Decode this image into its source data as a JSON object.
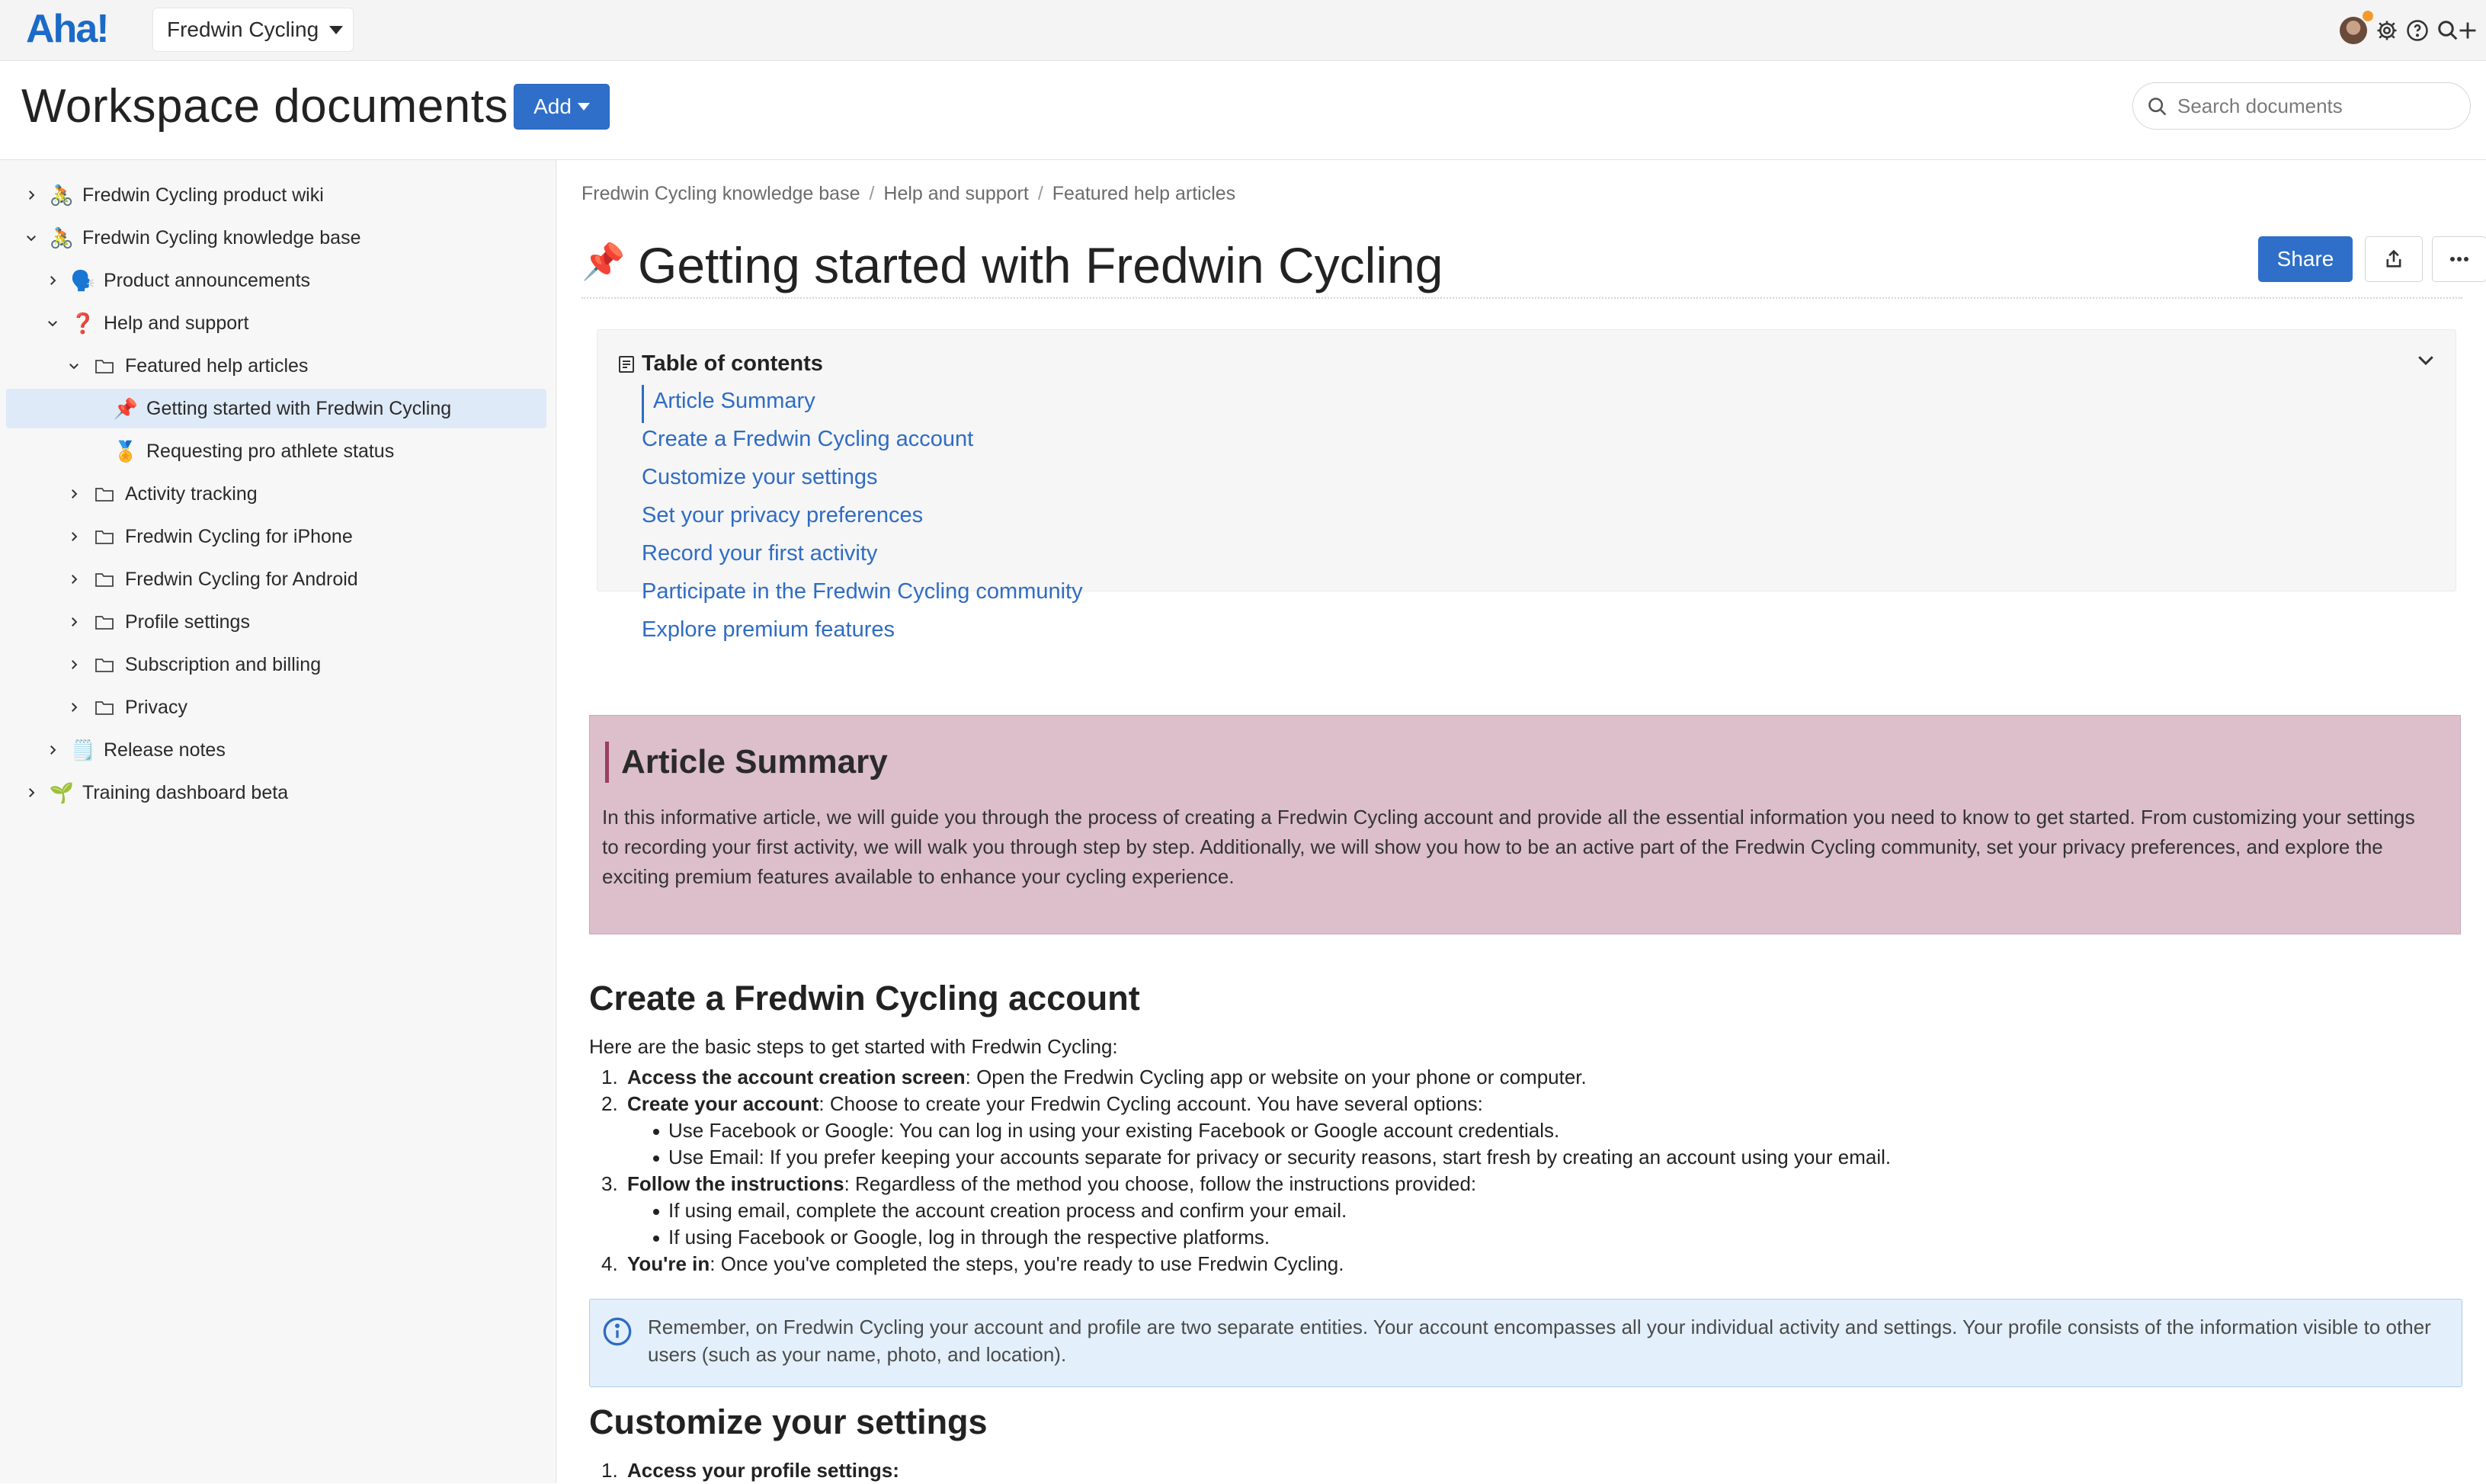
{
  "topbar": {
    "logo": "Aha!",
    "workspace": "Fredwin Cycling"
  },
  "header": {
    "title": "Workspace documents",
    "add_label": "Add",
    "search_placeholder": "Search documents"
  },
  "sidebar": {
    "items": [
      {
        "label": "Fredwin Cycling product wiki",
        "icon": "🚴",
        "level": 0,
        "expanded": false,
        "kind": "emoji"
      },
      {
        "label": "Fredwin Cycling knowledge base",
        "icon": "🚴",
        "level": 0,
        "expanded": true,
        "kind": "emoji"
      },
      {
        "label": "Product announcements",
        "icon": "🗣️",
        "level": 1,
        "expanded": false,
        "kind": "emoji"
      },
      {
        "label": "Help and support",
        "icon": "❓",
        "level": 1,
        "expanded": true,
        "kind": "emoji"
      },
      {
        "label": "Featured help articles",
        "icon": "folder",
        "level": 2,
        "expanded": true,
        "kind": "folder"
      },
      {
        "label": "Getting started with Fredwin Cycling",
        "icon": "📌",
        "level": 3,
        "expanded": null,
        "kind": "emoji",
        "selected": true
      },
      {
        "label": "Requesting pro athlete status",
        "icon": "🏅",
        "level": 3,
        "expanded": null,
        "kind": "emoji"
      },
      {
        "label": "Activity tracking",
        "icon": "folder",
        "level": 2,
        "expanded": false,
        "kind": "folder"
      },
      {
        "label": "Fredwin Cycling for iPhone",
        "icon": "folder",
        "level": 2,
        "expanded": false,
        "kind": "folder"
      },
      {
        "label": "Fredwin Cycling for Android",
        "icon": "folder",
        "level": 2,
        "expanded": false,
        "kind": "folder"
      },
      {
        "label": "Profile settings",
        "icon": "folder",
        "level": 2,
        "expanded": false,
        "kind": "folder"
      },
      {
        "label": "Subscription and billing",
        "icon": "folder",
        "level": 2,
        "expanded": false,
        "kind": "folder"
      },
      {
        "label": "Privacy",
        "icon": "folder",
        "level": 2,
        "expanded": false,
        "kind": "folder"
      },
      {
        "label": "Release notes",
        "icon": "🗒️",
        "level": 1,
        "expanded": false,
        "kind": "emoji"
      },
      {
        "label": "Training dashboard beta",
        "icon": "🌱",
        "level": 0,
        "expanded": false,
        "kind": "emoji"
      }
    ]
  },
  "main": {
    "breadcrumb": [
      "Fredwin Cycling knowledge base",
      "Help and support",
      "Featured help articles"
    ],
    "doc_icon": "📌",
    "doc_title": "Getting started with Fredwin Cycling",
    "share_label": "Share",
    "toc": {
      "title": "Table of contents",
      "items": [
        "Article Summary",
        "Create a Fredwin Cycling account",
        "Customize your settings",
        "Set your privacy preferences",
        "Record your first activity",
        "Participate in the Fredwin Cycling community",
        "Explore premium features"
      ]
    },
    "summary": {
      "title": "Article Summary",
      "body": "In this informative article, we will guide you through the process of creating a Fredwin Cycling account and provide all the essential information you need to know to get started. From customizing your settings to recording your first activity, we will walk you through step by step. Additionally, we will show you how to be an active part of the Fredwin Cycling community, set your privacy preferences, and explore the exciting premium features available to enhance your cycling experience."
    },
    "section1": {
      "title": "Create a Fredwin Cycling account",
      "intro": "Here are the basic steps to get started with Fredwin Cycling:",
      "steps": [
        {
          "num": "1.",
          "bold": "Access the account creation screen",
          "text": ": Open the Fredwin Cycling app or website on your phone or computer.",
          "subs": []
        },
        {
          "num": "2.",
          "bold": "Create your account",
          "text": ": Choose to create your Fredwin Cycling account. You have several options:",
          "subs": [
            "Use Facebook or Google: You can log in using your existing Facebook or Google account credentials.",
            "Use Email: If you prefer keeping your accounts separate for privacy or security reasons, start fresh by creating an account using your email."
          ]
        },
        {
          "num": "3.",
          "bold": "Follow the instructions",
          "text": ": Regardless of the method you choose, follow the instructions provided:",
          "subs": [
            "If using email, complete the account creation process and confirm your email.",
            "If using Facebook or Google, log in through the respective platforms."
          ]
        },
        {
          "num": "4.",
          "bold": "You're in",
          "text": ": Once you've completed the steps, you're ready to use Fredwin Cycling.",
          "subs": []
        }
      ],
      "note": "Remember, on Fredwin Cycling your account and profile are two separate entities. Your account encompasses all your individual activity and settings. Your profile consists of the information visible to other users (such as your name, photo, and location)."
    },
    "section2": {
      "title": "Customize your settings",
      "first_step_num": "1.",
      "first_step": "Access your profile settings:"
    }
  },
  "colors": {
    "brand": "#1b6ac9",
    "primary_button": "#2f6fc9",
    "link": "#2f6cc4",
    "summary_bg": "#dcbfcb",
    "info_bg": "#e3f0fb",
    "selected_row": "#dfeaf8"
  }
}
